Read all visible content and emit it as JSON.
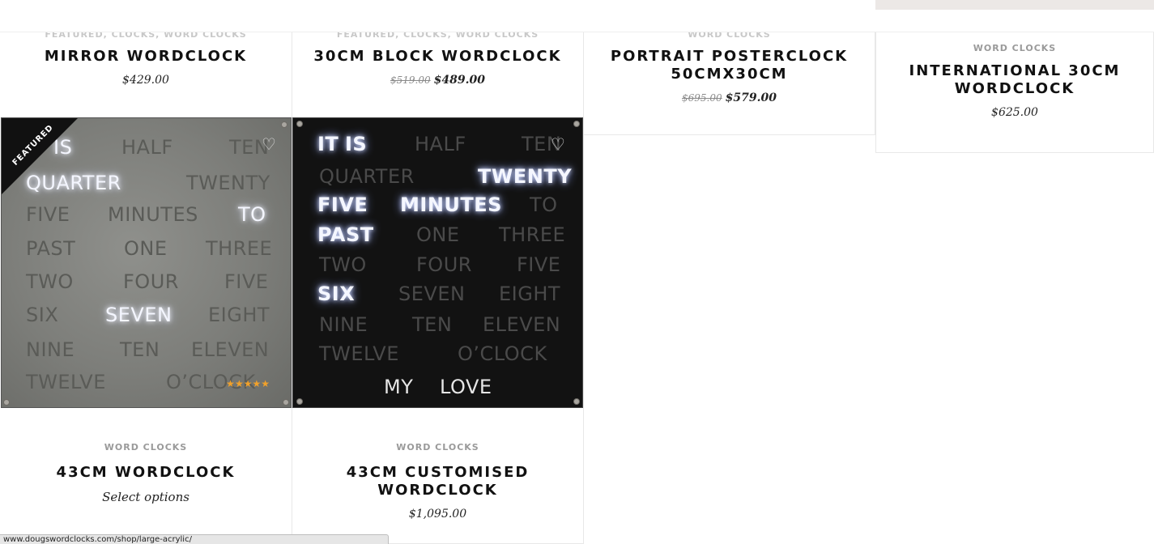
{
  "products_top": [
    {
      "category": "FEATURED, CLOCKS, WORD CLOCKS",
      "title": "MIRROR WORDCLOCK",
      "price": "$429.00",
      "old_price": "",
      "new_price": ""
    },
    {
      "category": "FEATURED, CLOCKS, WORD CLOCKS",
      "title": "30CM BLOCK WORDCLOCK",
      "price": "",
      "old_price": "$519.00",
      "new_price": "$489.00"
    },
    {
      "category": "WORD CLOCKS",
      "title": "PORTRAIT POSTERCLOCK 50CMX30CM",
      "price": "",
      "old_price": "$695.00",
      "new_price": "$579.00"
    },
    {
      "category": "WORD CLOCKS",
      "title": "INTERNATIONAL 30CM WORDCLOCK",
      "price": "$625.00",
      "old_price": "",
      "new_price": ""
    }
  ],
  "products_bottom": [
    {
      "badge": "FEATURED",
      "rating_stars": 5,
      "category": "WORD CLOCKS",
      "title": "43CM WORDCLOCK",
      "action": "Select options",
      "clock_words": [
        "IS",
        "HALF",
        "TEN",
        "QUARTER",
        "TWENTY",
        "FIVE",
        "MINUTES",
        "TO",
        "PAST",
        "ONE",
        "THREE",
        "TWO",
        "FOUR",
        "FIVE",
        "SIX",
        "SEVEN",
        "EIGHT",
        "NINE",
        "TEN",
        "ELEVEN",
        "TWELVE",
        "O’CLOCK"
      ]
    },
    {
      "category": "WORD CLOCKS",
      "title": "43CM CUSTOMISED WORDCLOCK",
      "price": "$1,095.00",
      "clock_words": [
        "IT",
        "IS",
        "HALF",
        "TEN",
        "QUARTER",
        "TWENTY",
        "FIVE",
        "MINUTES",
        "TO",
        "PAST",
        "ONE",
        "THREE",
        "TWO",
        "FOUR",
        "FIVE",
        "SIX",
        "SEVEN",
        "EIGHT",
        "NINE",
        "TEN",
        "ELEVEN",
        "TWELVE",
        "O’CLOCK",
        "MY",
        "LOVE"
      ]
    }
  ],
  "icons": {
    "wishlist": "heart-outline-icon",
    "rating": "star-icon"
  },
  "colors": {
    "star": "#f1a12a",
    "ribbon": "#111111",
    "category": "#9a9a9a"
  },
  "status_bar": {
    "url": "www.dougswordclocks.com/shop/large-acrylic/"
  }
}
